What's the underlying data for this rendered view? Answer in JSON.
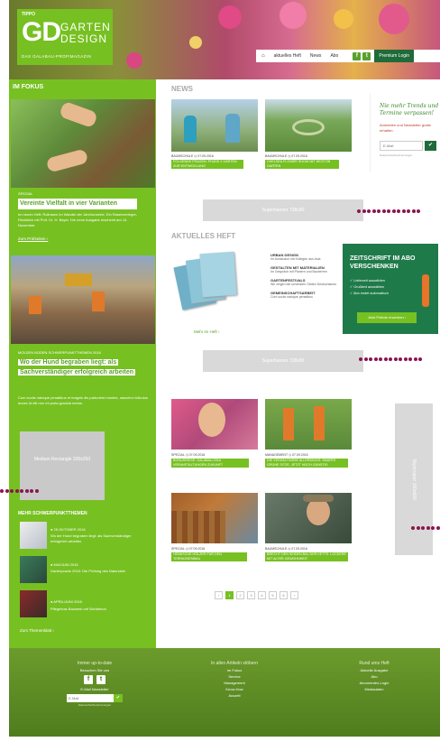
{
  "header": {
    "logo_small": "TIPPO",
    "logo_gd": "GD",
    "logo_garten": "GARTEN",
    "logo_design": "DESIGN",
    "logo_sub": "DAS GALABAU-PROFIMAGAZIN",
    "nav": {
      "home": "⌂",
      "items": [
        "aktuelles Heft",
        "News",
        "Abo"
      ],
      "premium": "Premium Login"
    }
  },
  "sidebar": {
    "title": "IM FOKUS",
    "article1": {
      "label": "SPEZIAL",
      "title": "Vereinte Vielfalt in vier Varianten",
      "text": "Im neuen Heft: Rollrasen im Wandel der Jahrhunderte. Ein Rasenverleger-Rückblick mit Prof. Dr. H. Bayer. Die neue Ausgabe erscheint am 14. November.",
      "link": "Zum Prüfseiten ›"
    },
    "article2": {
      "label": "MOLDEN BODEN SCHWERPUNKTTHEMEN 2016",
      "title": "Wo der Hund begraben liegt: als Sachverständiger erfolgreich arbeiten",
      "text": "Cum sociis natoque penatibus et magnis dis parturient montes, nascetur ridiculus donec id elit non mi porta gravida metus."
    },
    "ad": "Medium Rectangle 300x250",
    "more_title": "MEHR SCHWERPUNKTTHEMEN",
    "more": [
      {
        "meta": "● 25.OKTOBER 2016",
        "title": "Wo der Hund begraben liegt: als Sachverständiger erfolgreich arbeiten"
      },
      {
        "meta": "● MAI/JUNI 2016",
        "title": "Gartenpraxis 2016: Die Prüfung des Naturstein"
      },
      {
        "meta": "● APRIL/JUNI 2016",
        "title": "Pflegeleas Bauwerk mit Sichtbeton"
      }
    ],
    "more_link": "Zum Themenblatt ›"
  },
  "news": {
    "title": "NEWS",
    "items": [
      {
        "meta": "BAUMSCHULE  ◷ 07.09.2016",
        "title": "FOLGENDE FRAGEN: PHASE 2 GARTEN ZUR ENTWICKLUNG"
      },
      {
        "meta": "BAUMSCHULE  ◷ 07.09.2016",
        "title": "CHELSEA FLOWER SHOW MIT HEGTON GARTEN"
      }
    ],
    "newsletter": {
      "headline": "Nie mehr Trends und Termine verpassen!",
      "text": "Anmelden und Newsletter gratis erhalten.",
      "placeholder": "E-Mail",
      "button": "✔",
      "small": "Datenschutzbestimmungen"
    },
    "ad": "Superbanner 728x90"
  },
  "heft": {
    "title": "AKTUELLES HEFT",
    "more": "Mehr im Heft ›",
    "items": [
      {
        "title": "URBAN DESIGN",
        "text": "Im Austausch mit Kollegen aus Asia"
      },
      {
        "title": "GESTALTEN MIT MATERIALIEN",
        "text": "Im Gespräch mit Planern und Bauherren"
      },
      {
        "title": "GARTENFESTIVALS",
        "text": "Wir zeigen die schönsten Gärten Deutschlands"
      },
      {
        "title": "GEMEINSCHAFTSARBEIT",
        "text": "Cum sociis natoque penatibus"
      }
    ],
    "abo": {
      "title": "ZEITSCHRIFT IM ABO VERSCHENKEN",
      "checks": [
        "✓ Lieferzeit auswählen",
        "✓ Grußtext auswählen",
        "✓ Abo endet automatisch"
      ],
      "button": "Jetzt Prämie erwerben ›"
    },
    "ad": "Superbanner 728x90"
  },
  "articles": {
    "items": [
      {
        "meta": "SPECIAL  ◷ 07.09.2016",
        "title": "BONUSREISE: GALABAU 2016 VERANSTALTUNGEN ZUKUNFT"
      },
      {
        "meta": "MANAGEMENT  ◷ 07.09.2016",
        "title": "DIE VERHALTNISSE ALLERDINGS: SMARTE GRÜNE SITZE, JETZT NOCH GÜNSTIG"
      },
      {
        "meta": "SPECIAL  ◷ 07.09.2016",
        "title": "HEIMISCHE HÖLZER FÜR DEN TERRASSENBAU"
      },
      {
        "meta": "BAUMSCHULE  ◷ 07.09.2016",
        "title": "BRECHT DEN SEIDEN BAL DER KETTE: LOCKERE MIT ALTER GEWOHNHEIT"
      }
    ],
    "skyscraper": "Skyscraper 160x600",
    "pagination": [
      "‹",
      "1",
      "2",
      "3",
      "4",
      "5",
      "6",
      "›"
    ]
  },
  "footer": {
    "col1": {
      "title": "Immer up-to-date",
      "follow": "Besuchen Sie uns",
      "newsletter": "E-Mail Newsletter",
      "placeholder": "E-Mail",
      "small": "Datenschutzbestimmungen"
    },
    "col2": {
      "title": "In allen Artikeln stöbern",
      "links": [
        "Im Fokus",
        "Service",
        "Management",
        "Know-How",
        "Auszeit"
      ]
    },
    "col3": {
      "title": "Rund ums Heft",
      "links": [
        "Aktuelle Ausgabe",
        "Abo",
        "Abonnenten-Login",
        "Mediadaten"
      ]
    }
  },
  "colors": {
    "accent": "#77c022",
    "dark_green": "#1f6b3a",
    "dots": "#8a1550"
  }
}
